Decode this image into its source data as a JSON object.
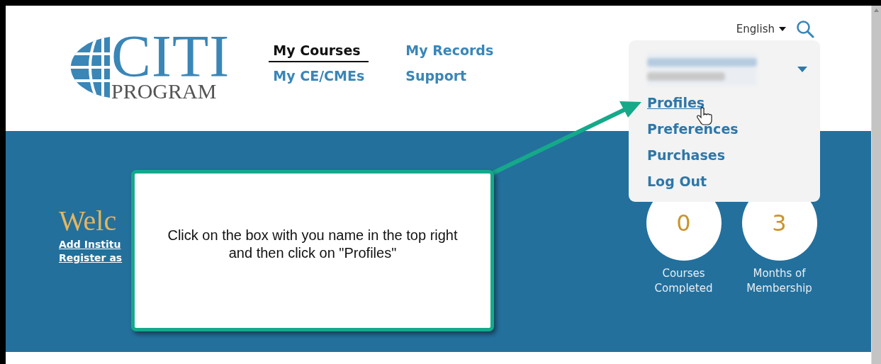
{
  "logo": {
    "title": "CITI",
    "subtitle": "PROGRAM"
  },
  "nav": [
    {
      "label": "My Courses",
      "selected": true
    },
    {
      "label": "My Records",
      "selected": false
    },
    {
      "label": "My CE/CMEs",
      "selected": false
    },
    {
      "label": "Support",
      "selected": false
    }
  ],
  "language": {
    "label": "English"
  },
  "user_menu": {
    "expanded": true,
    "items": [
      {
        "label": "Profiles",
        "selected": true
      },
      {
        "label": "Preferences",
        "selected": false
      },
      {
        "label": "Purchases",
        "selected": false
      },
      {
        "label": "Log Out",
        "selected": false
      }
    ]
  },
  "welcome": {
    "heading": "Welc",
    "links": [
      "Add Institu",
      "Register as"
    ]
  },
  "stats": [
    {
      "value": "0",
      "label": "Courses Completed"
    },
    {
      "value": "3",
      "label": "Months of Membership"
    }
  ],
  "callout": {
    "text": "Click on the box with you name in the top right and then click on \"Profiles\""
  }
}
